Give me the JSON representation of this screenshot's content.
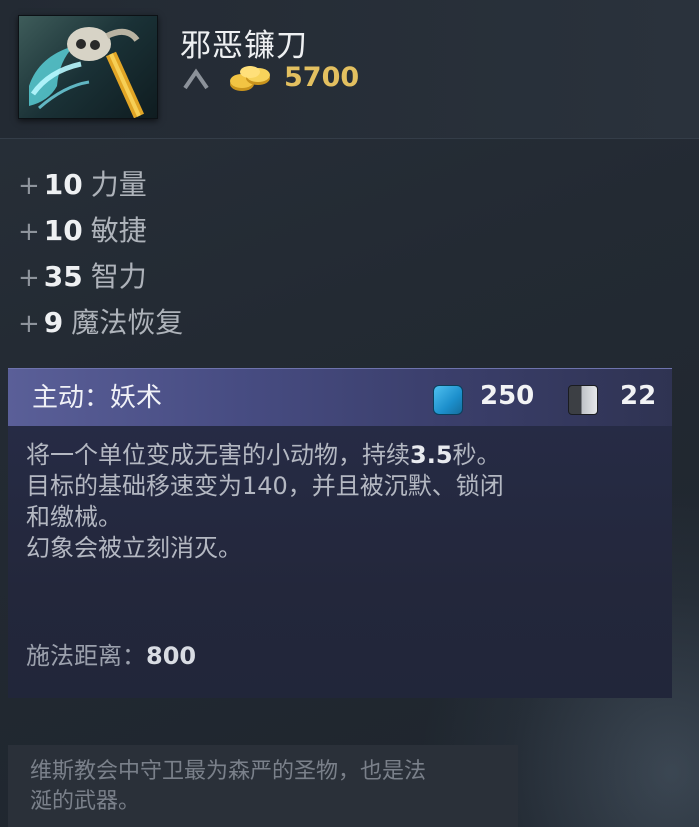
{
  "item": {
    "name": "邪恶镰刀",
    "cost": "5700",
    "icon": "guinsoo-scythe-icon",
    "colors": {
      "cost": "#e3c060",
      "ability_header": "#4a4f86"
    }
  },
  "attributes": [
    {
      "sign": "+",
      "value": "10",
      "name": "力量"
    },
    {
      "sign": "+",
      "value": "10",
      "name": "敏捷"
    },
    {
      "sign": "+",
      "value": "35",
      "name": "智力"
    },
    {
      "sign": "+",
      "value": "9",
      "name": "魔法恢复"
    }
  ],
  "ability": {
    "title": "主动：妖术",
    "mana_cost": "250",
    "cooldown": "22",
    "desc_line1_pre": "将一个单位变成无害的小动物，持续",
    "desc_line1_value": "3.5",
    "desc_line1_post": "秒。",
    "desc_line2": "目标的基础移速变为140，并且被沉默、锁闭",
    "desc_line3": "和缴械。",
    "desc_line4": "幻象会被立刻消灭。",
    "range_label": "施法距离：",
    "range_value": "800"
  },
  "lore": {
    "line1": "维斯教会中守卫最为森严的圣物，也是法",
    "line2": "涎的武器。"
  }
}
